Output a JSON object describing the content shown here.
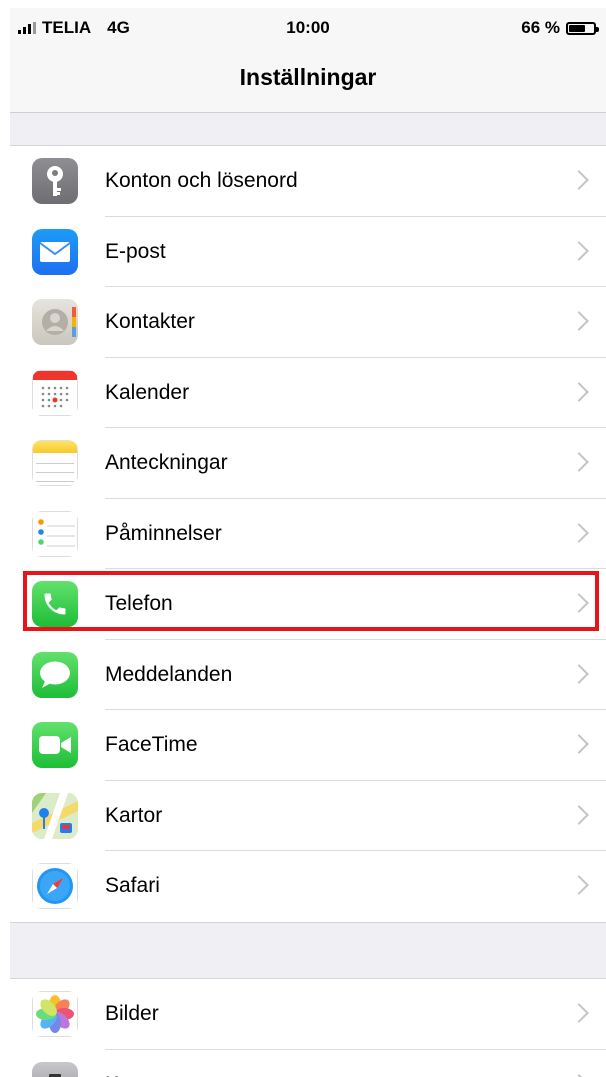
{
  "status_bar": {
    "carrier": "TELIA",
    "network": "4G",
    "time": "10:00",
    "battery_percent": "66 %",
    "battery_level": 0.66
  },
  "nav": {
    "title": "Inställningar"
  },
  "group1": [
    {
      "label": "Konton och lösenord",
      "icon": "key-icon"
    },
    {
      "label": "E-post",
      "icon": "mail-icon"
    },
    {
      "label": "Kontakter",
      "icon": "contacts-icon"
    },
    {
      "label": "Kalender",
      "icon": "calendar-icon"
    },
    {
      "label": "Anteckningar",
      "icon": "notes-icon"
    },
    {
      "label": "Påminnelser",
      "icon": "reminders-icon"
    },
    {
      "label": "Telefon",
      "icon": "phone-icon",
      "highlighted": true
    },
    {
      "label": "Meddelanden",
      "icon": "messages-icon"
    },
    {
      "label": "FaceTime",
      "icon": "facetime-icon"
    },
    {
      "label": "Kartor",
      "icon": "maps-icon"
    },
    {
      "label": "Safari",
      "icon": "safari-icon"
    }
  ],
  "group2": [
    {
      "label": "Bilder",
      "icon": "photos-icon"
    },
    {
      "label": "K",
      "icon": "camera-icon"
    }
  ],
  "colors": {
    "highlight": "#e8141a",
    "chevron": "#c4c4c9",
    "background": "#efeff4"
  }
}
